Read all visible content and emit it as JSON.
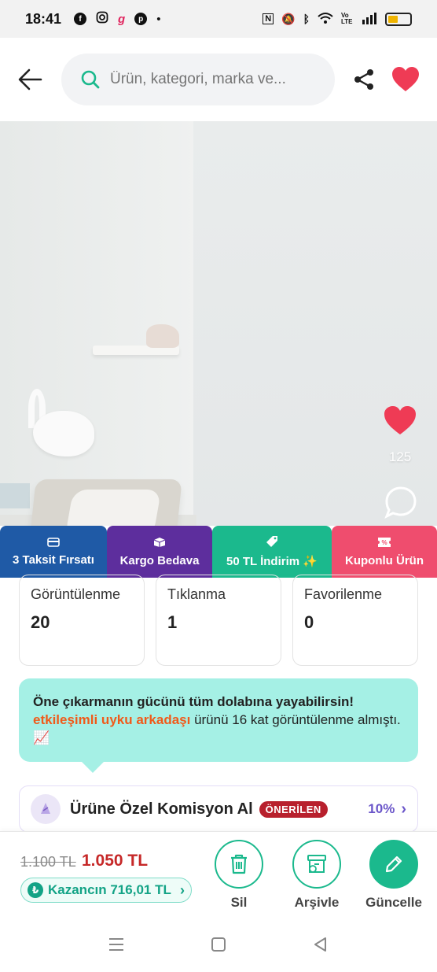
{
  "status": {
    "time": "18:41",
    "left_icons": [
      "facebook-icon",
      "instagram-icon",
      "app-icon",
      "pinterest-icon",
      "dot-icon"
    ],
    "right_icons": [
      "nfc-icon",
      "mute-icon",
      "bluetooth-icon",
      "wifi-icon",
      "volte-icon",
      "signal-icon",
      "battery-icon"
    ],
    "volte_label": "Vo LTE"
  },
  "header": {
    "search_placeholder": "Ürün, kategori, marka ve..."
  },
  "product": {
    "like_count": "125"
  },
  "badges": [
    {
      "label": "3 Taksit Fırsatı",
      "icon": "credit-card-icon",
      "color": "#1f5aa6"
    },
    {
      "label": "Kargo Bedava",
      "icon": "box-icon",
      "color": "#5d2e9d"
    },
    {
      "label": "50 TL İndirim ✨",
      "icon": "tag-icon",
      "color": "#1bb98d"
    },
    {
      "label": "Kuponlu Ürün",
      "icon": "coupon-icon",
      "color": "#ef4d6e"
    }
  ],
  "stats": [
    {
      "label": "Görüntülenme",
      "value": "20"
    },
    {
      "label": "Tıklanma",
      "value": "1"
    },
    {
      "label": "Favorilenme",
      "value": "0"
    }
  ],
  "tip": {
    "title": "Öne çıkarmanın gücünü tüm dolabına yayabilirsin!",
    "highlight": "etkileşimli uyku arkadaşı",
    "rest": " ürünü 16 kat görüntülenme almıştı. 📈"
  },
  "commission": {
    "label": "Ürüne Özel Komisyon Al",
    "badge": "ÖNERİLEN",
    "percent": "10%"
  },
  "pricing": {
    "old_price": "1.100 TL",
    "new_price": "1.050 TL",
    "earnings": "Kazancın 716,01 TL"
  },
  "actions": {
    "delete": "Sil",
    "archive": "Arşivle",
    "update": "Güncelle"
  },
  "colors": {
    "accent": "#1bb98d",
    "like": "#ef3b55",
    "price": "#c62828"
  }
}
